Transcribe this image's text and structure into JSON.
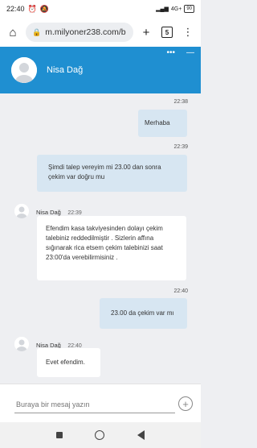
{
  "status_bar": {
    "time": "22:40",
    "network": "4G+",
    "battery": "90"
  },
  "browser": {
    "url": "m.milyoner238.com/b",
    "tab_count": "5"
  },
  "chat_header": {
    "agent_name": "Nisa Dağ"
  },
  "messages": [
    {
      "direction": "out",
      "time": "22:38",
      "text": "Merhaba"
    },
    {
      "direction": "out",
      "time": "22:39",
      "text": "Şimdi talep vereyim mi 23.00 dan sonra çekim var doğru mu"
    },
    {
      "direction": "in",
      "sender": "Nisa Dağ",
      "time": "22:39",
      "text": "Efendim kasa takviyesinden dolayı çekim talebiniz reddedilmiştir . Sizlerin affına sığınarak rica etsem çekim talebinizi saat 23:00'da verebilirmisiniz ."
    },
    {
      "direction": "out",
      "time": "22:40",
      "text": "23.00 da çekim var mı"
    },
    {
      "direction": "in",
      "sender": "Nisa Dağ",
      "time": "22:40",
      "text": "Evet efendim."
    }
  ],
  "input": {
    "placeholder": "Buraya bir mesaj yazın"
  },
  "colors": {
    "header": "#1f8fd1",
    "outgoing_bubble": "#d7e6f2",
    "incoming_bubble": "#ffffff",
    "background": "#eeeff2"
  }
}
